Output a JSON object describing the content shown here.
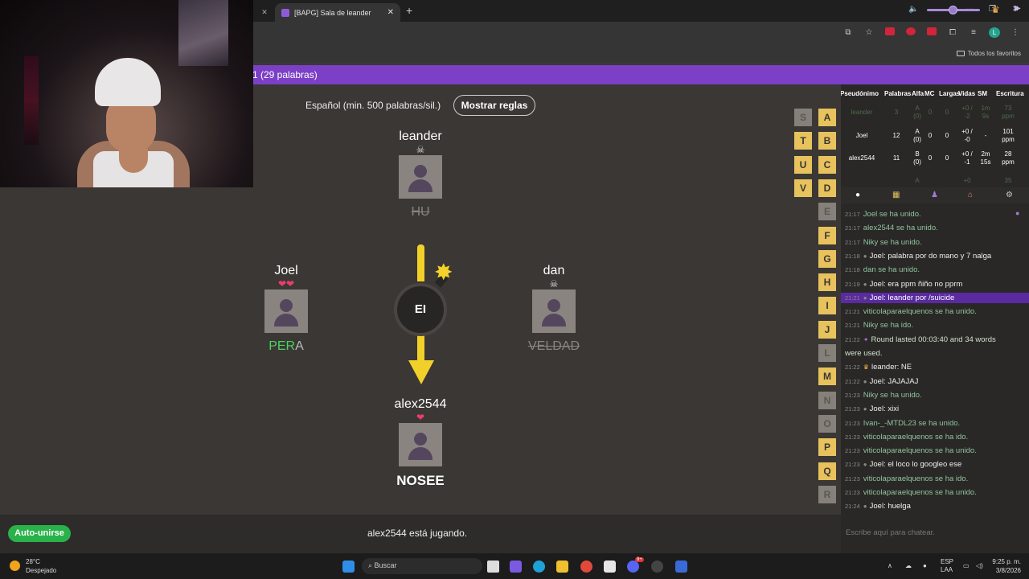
{
  "browser": {
    "prev_tab_close": "✕",
    "tab_title": "[BAPG] Sala de leander",
    "tab_close": "✕",
    "new_tab": "+",
    "bookmarks_label": "Todos los favoritos"
  },
  "header": {
    "title": "1 (29 palabras)"
  },
  "game": {
    "language": "Español (min. 500 palabras/sil.)",
    "rules_button": "Mostrar reglas",
    "bomb_syllable": "EI",
    "status": "alex2544 está jugando.",
    "auto_join": "Auto-unirse",
    "players": [
      {
        "name": "leander",
        "marks": "☠",
        "word": "HU",
        "state": "dead"
      },
      {
        "name": "Joel",
        "marks": "❤❤",
        "word_typed": "PER",
        "word_rest": "A",
        "state": "alive"
      },
      {
        "name": "dan",
        "marks": "☠",
        "word": "VELDAD",
        "state": "dead"
      },
      {
        "name": "alex2544",
        "marks": "❤",
        "word": "NOSEE",
        "state": "current"
      }
    ],
    "letters_col1": [
      "S",
      "T",
      "U",
      "V"
    ],
    "letters_col2": [
      "A",
      "B",
      "C",
      "D",
      "E",
      "F",
      "G",
      "H",
      "I",
      "J",
      "L",
      "M",
      "N",
      "O",
      "P",
      "Q",
      "R"
    ],
    "letters_col2_on": [
      true,
      true,
      true,
      true,
      false,
      true,
      true,
      true,
      true,
      true,
      false,
      true,
      false,
      false,
      true,
      true,
      false
    ]
  },
  "scoreboard": {
    "headers": [
      "Pseudónimo",
      "Palabras",
      "Alfa",
      "MC",
      "Largas",
      "Vidas",
      "SM",
      "Escritura"
    ],
    "rows": [
      {
        "name": "leander",
        "palabras": "3",
        "alfa": "A (0)",
        "mc": "0",
        "largas": "0",
        "vidas": "+0 / -2",
        "sm": "1m 9s",
        "escritura": "73 ppm",
        "dim": true
      },
      {
        "name": "Joel",
        "palabras": "12",
        "alfa": "A (0)",
        "mc": "0",
        "largas": "0",
        "vidas": "+0 / -0",
        "sm": "-",
        "escritura": "101 ppm",
        "dim": false
      },
      {
        "name": "alex2544",
        "palabras": "11",
        "alfa": "B (0)",
        "mc": "0",
        "largas": "0",
        "vidas": "+0 / -1",
        "sm": "2m 15s",
        "escritura": "28 ppm",
        "dim": false
      },
      {
        "name": "",
        "palabras": "",
        "alfa": "A",
        "mc": "",
        "largas": "",
        "vidas": "+0",
        "sm": "",
        "escritura": "35",
        "dim": true
      }
    ]
  },
  "chat": {
    "placeholder": "Escribe aquí para chatear.",
    "messages": [
      {
        "time": "21:17",
        "text": "Joel se ha unido.",
        "kind": "sys"
      },
      {
        "time": "21:17",
        "text": "alex2544 se ha unido.",
        "kind": "sys"
      },
      {
        "time": "21:17",
        "text": "Niky se ha unido.",
        "kind": "sys"
      },
      {
        "time": "21:18",
        "text": "Joel: palabra por do mano y 7 nalga",
        "kind": "usr"
      },
      {
        "time": "21:18",
        "text": "dan se ha unido.",
        "kind": "sys"
      },
      {
        "time": "21:19",
        "text": "Joel: era ppm ñiño no pprm",
        "kind": "usr"
      },
      {
        "time": "21:21",
        "text": "Joel: leander por /suicide",
        "kind": "hl"
      },
      {
        "time": "21:21",
        "text": "viticolaparaelquenos se ha unido.",
        "kind": "sys"
      },
      {
        "time": "21:21",
        "text": "Niky se ha ido.",
        "kind": "sys"
      },
      {
        "time": "21:22",
        "text": "Round lasted 00:03:40 and 34 words",
        "kind": "round"
      },
      {
        "time": "",
        "text": "were used.",
        "kind": "round2"
      },
      {
        "time": "21:22",
        "text": "leander: NE",
        "kind": "crown"
      },
      {
        "time": "21:22",
        "text": "Joel: JAJAJAJ",
        "kind": "usr"
      },
      {
        "time": "21:23",
        "text": "Niky se ha unido.",
        "kind": "sys"
      },
      {
        "time": "21:23",
        "text": "Joel: xixi",
        "kind": "usr"
      },
      {
        "time": "21:23",
        "text": "Ivan-_-MTDL23 se ha unido.",
        "kind": "sys"
      },
      {
        "time": "21:23",
        "text": "viticolaparaelquenos se ha ido.",
        "kind": "sys"
      },
      {
        "time": "21:23",
        "text": "viticolaparaelquenos se ha unido.",
        "kind": "sys"
      },
      {
        "time": "21:23",
        "text": "Joel: el loco lo googleo ese",
        "kind": "usr"
      },
      {
        "time": "21:23",
        "text": "viticolaparaelquenos se ha ido.",
        "kind": "sys"
      },
      {
        "time": "21:23",
        "text": "viticolaparaelquenos se ha unido.",
        "kind": "sys"
      },
      {
        "time": "21:24",
        "text": "Joel: huelga",
        "kind": "usr"
      }
    ]
  },
  "taskbar": {
    "temp": "28°C",
    "weather": "Despejado",
    "search": "Buscar",
    "lang": "ESP",
    "layout": "LAA",
    "time": "9:25 p. m.",
    "date": "3/8/2026",
    "badge": "9+"
  },
  "colors": {
    "accent": "#7b40c6",
    "letter_on": "#e7c25d",
    "letter_off": "#858079",
    "auto_join": "#2ab24a",
    "heart": "#ee3d6a"
  }
}
